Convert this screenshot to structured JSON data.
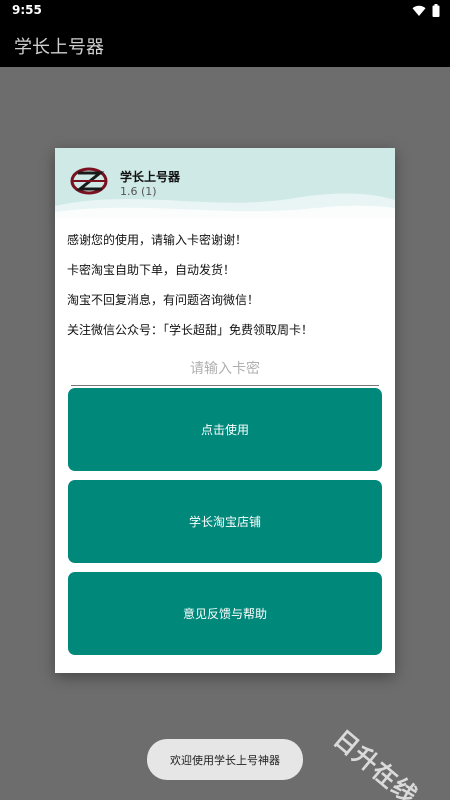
{
  "status_bar": {
    "time": "9:55"
  },
  "app_bar": {
    "title": "学长上号器"
  },
  "dialog": {
    "app_name": "学长上号器",
    "version": "1.6 (1)",
    "notice_lines": [
      "感谢您的使用，请输入卡密谢谢！",
      "卡密淘宝自助下单，自动发货！",
      "淘宝不回复消息，有问题咨询微信！",
      "关注微信公众号：「学长超甜」免费领取周卡！"
    ],
    "card_input": {
      "placeholder": "请输入卡密",
      "value": ""
    },
    "buttons": {
      "use": "点击使用",
      "shop": "学长淘宝店铺",
      "feedback": "意见反馈与帮助"
    }
  },
  "toast": {
    "text": "欢迎使用学长上号神器"
  },
  "watermark": {
    "text": "日升在线"
  },
  "colors": {
    "accent": "#00897b",
    "header_tint": "#cfe9e6",
    "scrim": "#6d6d6d",
    "toast_bg": "#e6e6e6"
  },
  "icons": [
    "wifi-icon",
    "battery-icon",
    "app-logo-icon"
  ]
}
